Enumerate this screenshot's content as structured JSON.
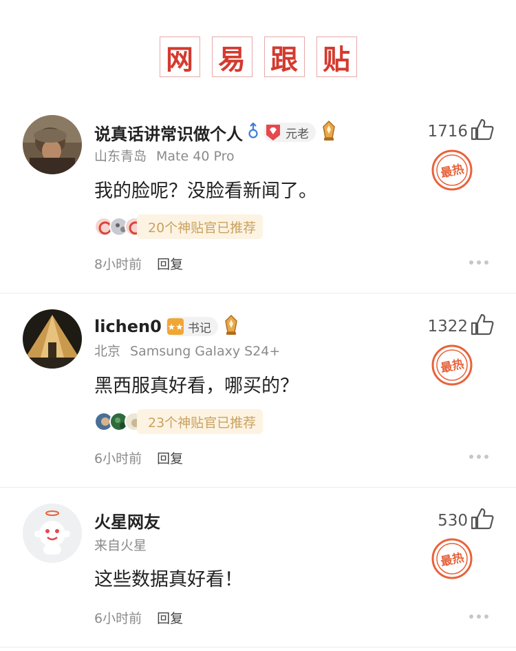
{
  "header": {
    "title_chars": [
      "网",
      "易",
      "跟",
      "贴"
    ]
  },
  "comments": [
    {
      "username": "说真话讲常识做个人",
      "badge_label": "元老",
      "location": "山东青岛",
      "device": "Mate 40 Pro",
      "content": "我的脸呢？没脸看新闻了。",
      "recommend_text": "20个神贴官已推荐",
      "time": "8小时前",
      "reply_label": "回复",
      "likes": "1716",
      "hot_label": "最热"
    },
    {
      "username": "lichen0",
      "badge_label": "书记",
      "location": "北京",
      "device": "Samsung Galaxy S24+",
      "content": "黑西服真好看，哪买的？",
      "recommend_text": "23个神贴官已推荐",
      "time": "6小时前",
      "reply_label": "回复",
      "likes": "1322",
      "hot_label": "最热"
    },
    {
      "username": "火星网友",
      "location": "来自火星",
      "content": "这些数据真好看！",
      "time": "6小时前",
      "reply_label": "回复",
      "likes": "530",
      "hot_label": "最热"
    }
  ],
  "colors": {
    "accent_red": "#d43a2f",
    "hot_orange": "#e8623a",
    "rec_text": "#c9a25e"
  }
}
